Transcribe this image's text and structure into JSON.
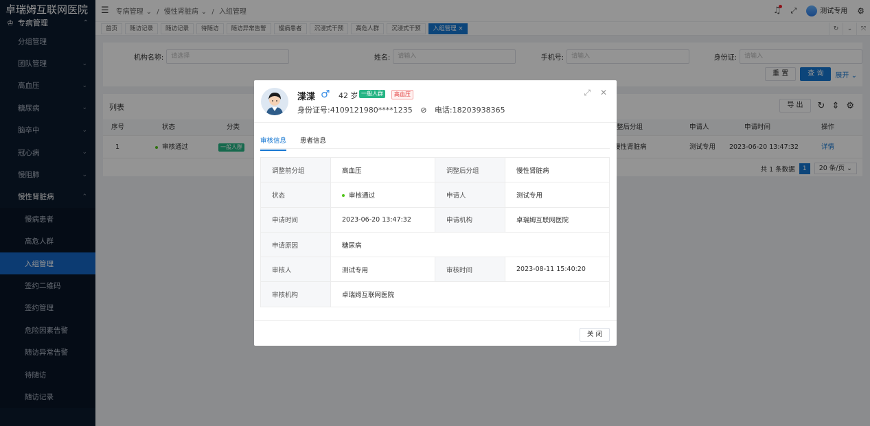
{
  "app_title": "卓瑞姆互联网医院",
  "sidebar": {
    "section": "专病管理",
    "items": [
      {
        "label": "分组管理",
        "arrow": false
      },
      {
        "label": "团队管理",
        "arrow": true
      },
      {
        "label": "高血压",
        "arrow": true
      },
      {
        "label": "糖尿病",
        "arrow": true
      },
      {
        "label": "脑卒中",
        "arrow": true
      },
      {
        "label": "冠心病",
        "arrow": true
      },
      {
        "label": "慢阻肺",
        "arrow": true
      },
      {
        "label": "慢性肾脏病",
        "arrow": true
      }
    ],
    "subitems": [
      "慢病患者",
      "高危人群",
      "入组管理",
      "签约二维码",
      "签约管理",
      "危险因素告警",
      "随访异常告警",
      "待随访",
      "随访记录"
    ]
  },
  "topbar": {
    "crumb1": "专病管理",
    "crumb2": "慢性肾脏病",
    "crumb3": "入组管理",
    "user": "测试专用"
  },
  "tabs": [
    "首页",
    "随访记录",
    "随访记录",
    "待随访",
    "随访异常告警",
    "慢病患者",
    "沉浸式干预",
    "高危人群",
    "沉浸式干预",
    "入组管理"
  ],
  "filter": {
    "org_label": "机构名称:",
    "org_placeholder": "请选择",
    "name_label": "姓名:",
    "name_placeholder": "请输入",
    "phone_label": "手机号:",
    "phone_placeholder": "请输入",
    "id_label": "身份证:",
    "id_placeholder": "请输入",
    "reset": "重 置",
    "query": "查 询",
    "expand": "展开"
  },
  "list": {
    "title": "列表",
    "export": "导 出",
    "headers": {
      "index": "序号",
      "status": "状态",
      "category": "分类",
      "after_group": "整后分组",
      "applicant": "申请人",
      "apply_time": "申请时间",
      "action": "操作"
    },
    "rows": [
      {
        "index": "1",
        "status": "审核通过",
        "category": "一般人群",
        "after_group": "慢性肾脏病",
        "applicant": "测试专用",
        "apply_time": "2023-06-20 13:47:32",
        "action": "详情"
      }
    ],
    "total": "共 1 条数据",
    "page": "1",
    "page_size": "20 条/页"
  },
  "modal": {
    "name": "渫渫",
    "sex": "♂",
    "age": "42 岁",
    "tag_group": "一般人群",
    "tag_disease": "高血压",
    "id_label": "身份证号:",
    "id_value": "4109121980****1235",
    "phone_label": "电话:",
    "phone_value": "18203938365",
    "tab_review": "审核信息",
    "tab_patient": "患者信息",
    "rows": {
      "before_group_k": "调整前分组",
      "before_group_v": "高血压",
      "after_group_k": "调整后分组",
      "after_group_v": "慢性肾脏病",
      "status_k": "状态",
      "status_v": "审核通过",
      "applicant_k": "申请人",
      "applicant_v": "测试专用",
      "apply_time_k": "申请时间",
      "apply_time_v": "2023-06-20 13:47:32",
      "apply_org_k": "申请机构",
      "apply_org_v": "卓瑞姆互联网医院",
      "reason_k": "申请原因",
      "reason_v": "糖尿病",
      "reviewer_k": "审核人",
      "reviewer_v": "测试专用",
      "review_time_k": "审核时间",
      "review_time_v": "2023-08-11 15:40:20",
      "review_org_k": "审核机构",
      "review_org_v": "卓瑞姆互联网医院"
    },
    "close": "关 闭"
  }
}
